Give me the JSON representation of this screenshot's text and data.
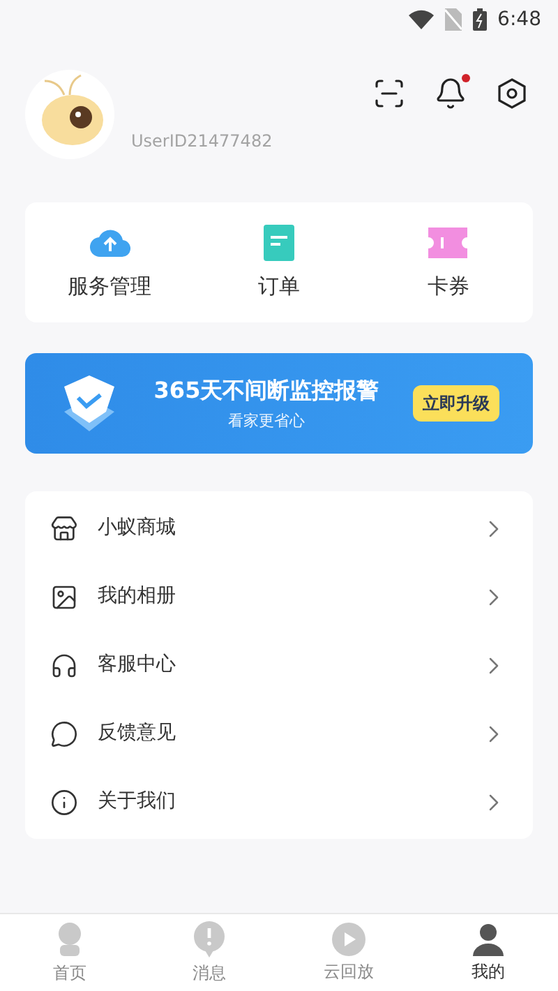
{
  "status_bar": {
    "time": "6:48"
  },
  "profile": {
    "user_id": "UserID21477482",
    "notification_dot": true
  },
  "quick_actions": [
    {
      "kind": "cloud",
      "label": "服务管理"
    },
    {
      "kind": "order",
      "label": "订单"
    },
    {
      "kind": "coupon",
      "label": "卡券"
    }
  ],
  "banner": {
    "title": "365天不间断监控报警",
    "subtitle": "看家更省心",
    "button": "立即升级"
  },
  "menu": [
    {
      "kind": "store",
      "label": "小蚁商城"
    },
    {
      "kind": "album",
      "label": "我的相册"
    },
    {
      "kind": "service",
      "label": "客服中心"
    },
    {
      "kind": "feedback",
      "label": "反馈意见"
    },
    {
      "kind": "about",
      "label": "关于我们"
    }
  ],
  "tabs": [
    {
      "kind": "home",
      "label": "首页",
      "selected": false
    },
    {
      "kind": "message",
      "label": "消息",
      "selected": false
    },
    {
      "kind": "cloud",
      "label": "云回放",
      "selected": false
    },
    {
      "kind": "me",
      "label": "我的",
      "selected": true
    }
  ]
}
